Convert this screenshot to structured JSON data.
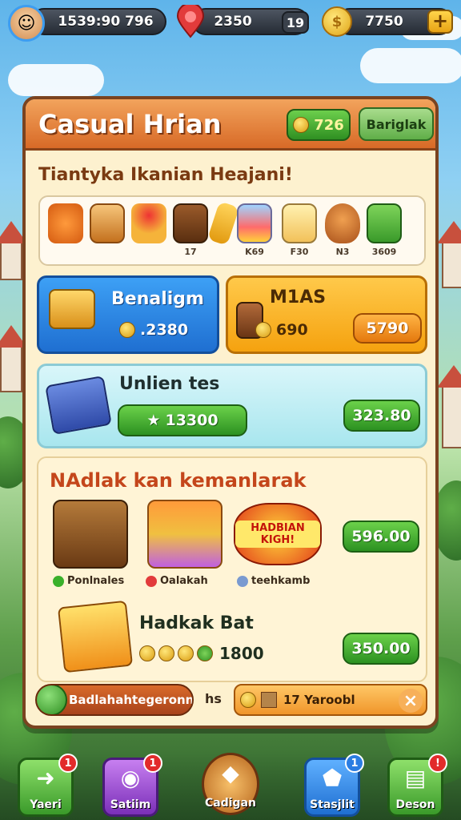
{
  "topbar": {
    "player_stat": "1539:90 796",
    "gems": "2350",
    "gem_count_small": "19",
    "coins": "7750",
    "add_label": "+"
  },
  "panel": {
    "title": "Casual Hrian",
    "header_coins": "726",
    "header_button": "Bariglak",
    "subtitle": "Tiantyka Ikanian Heajani!"
  },
  "item_strip": {
    "items": [
      {
        "icon": "bowl-icon",
        "label": ""
      },
      {
        "icon": "juice-glass-icon",
        "label": ""
      },
      {
        "icon": "cake-icon",
        "label": ""
      },
      {
        "icon": "tea-cup-icon",
        "label": "17"
      },
      {
        "icon": "bread-icon",
        "label": ""
      },
      {
        "icon": "candy-jar-icon",
        "label": "K69"
      },
      {
        "icon": "honey-jar-icon",
        "label": "F30"
      },
      {
        "icon": "pot-icon",
        "label": "N3"
      },
      {
        "icon": "gift-box-icon",
        "label": "3609"
      }
    ]
  },
  "cards": {
    "blue": {
      "title": "Benaligm",
      "value": ".2380"
    },
    "orange": {
      "title": "M1AS",
      "value": "690",
      "button": "5790"
    },
    "cyan": {
      "title": "Unlien tes",
      "value": "13300",
      "button": "323.80"
    }
  },
  "rewards": {
    "title": "NAdlak kan kemanlarak",
    "items": [
      {
        "icon": "treasure-chest-icon",
        "label": "Ponlnales"
      },
      {
        "icon": "toy-blocks-icon",
        "label": "Oalakah"
      },
      {
        "icon": "badge-icon",
        "label": "teehkamb",
        "badge_text": "HADBIAN KIGH!"
      }
    ],
    "claim_button": "596.00",
    "second_title": "Hadkak Bat",
    "second_value": "1800",
    "second_button": "350.00"
  },
  "footer": {
    "left_text": "Badlahahtegeronnr",
    "suffix": "hs",
    "right_text": "17 Yaroobl",
    "close": "×"
  },
  "nav": [
    {
      "label": "Yaeri",
      "badge": "1",
      "color": "#5fc03a"
    },
    {
      "label": "Satiim",
      "badge": "1",
      "color": "#9b4fd1"
    },
    {
      "label": "Cadigan",
      "badge": "",
      "color": "#d88a2f"
    },
    {
      "label": "Stasjlit",
      "badge": "1",
      "color": "#2e8be6"
    },
    {
      "label": "Deson",
      "badge": "!",
      "color": "#5fc03a"
    }
  ]
}
